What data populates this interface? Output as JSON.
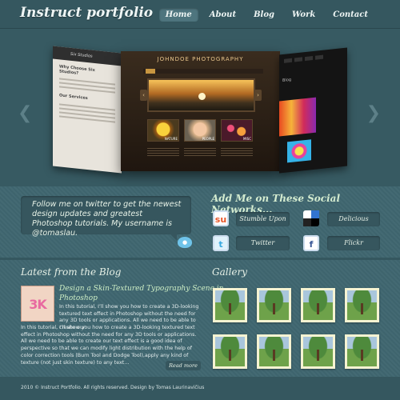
{
  "header": {
    "logo": "Instruct portfolio",
    "nav": [
      "Home",
      "About",
      "Blog",
      "Work",
      "Contact"
    ]
  },
  "slider": {
    "left_brand": "Six Studios",
    "left_heading": "Why Choose Six Studios?",
    "left_sub": "Our Services",
    "main_title": "JOHNDOE PHOTOGRAPHY",
    "thumb_labels": [
      "NATURE",
      "PEOPLE",
      "MISC"
    ],
    "right_heading": "Blog",
    "prev_glyph": "❮",
    "next_glyph": "❯"
  },
  "twitter": {
    "message": "Follow me on twitter to get the newest design updates and greatest Photoshop tutorials. My username is @tomaslau."
  },
  "social": {
    "title": "Add Me on These Social Networks...",
    "items": [
      {
        "label": "Stumble Upon",
        "glyph": "su",
        "color": "#ffffff",
        "icon": "stumbleupon-icon"
      },
      {
        "label": "Delicious",
        "glyph": "",
        "color": "#ffffff",
        "icon": "delicious-icon"
      },
      {
        "label": "Twitter",
        "glyph": "t",
        "color": "#7cc8ee",
        "icon": "twitter-icon"
      },
      {
        "label": "Flickr",
        "glyph": "f",
        "color": "#3b5998",
        "icon": "flickr-icon"
      }
    ]
  },
  "blog": {
    "heading": "Latest from the Blog",
    "thumb_text": "3K",
    "post_title": "Design a Skin-Textured Typography Scene in Photoshop",
    "post_intro": "In this tutorial, I’ll show you how to create a 3D-looking textured text effect in Photoshop without the need for any 3D tools or applications. All we need to be able to create our",
    "post_body": "In this tutorial, I’ll show you how to create a 3D-looking textured text effect in Photoshop without the need for any 3D tools or applications. All we need to be able to create our text effect is a good idea of perspective so that we can modify light distribution with the help of color correction tools (Burn Tool and Dodge Tool),apply any kind of texture (not just skin texture) to any text…",
    "read_more": "Read more"
  },
  "gallery": {
    "heading": "Gallery"
  },
  "footer": {
    "text": "2010 © Instruct Portfolio. All rights reserved. Design by Tomas Laurinavičius"
  }
}
